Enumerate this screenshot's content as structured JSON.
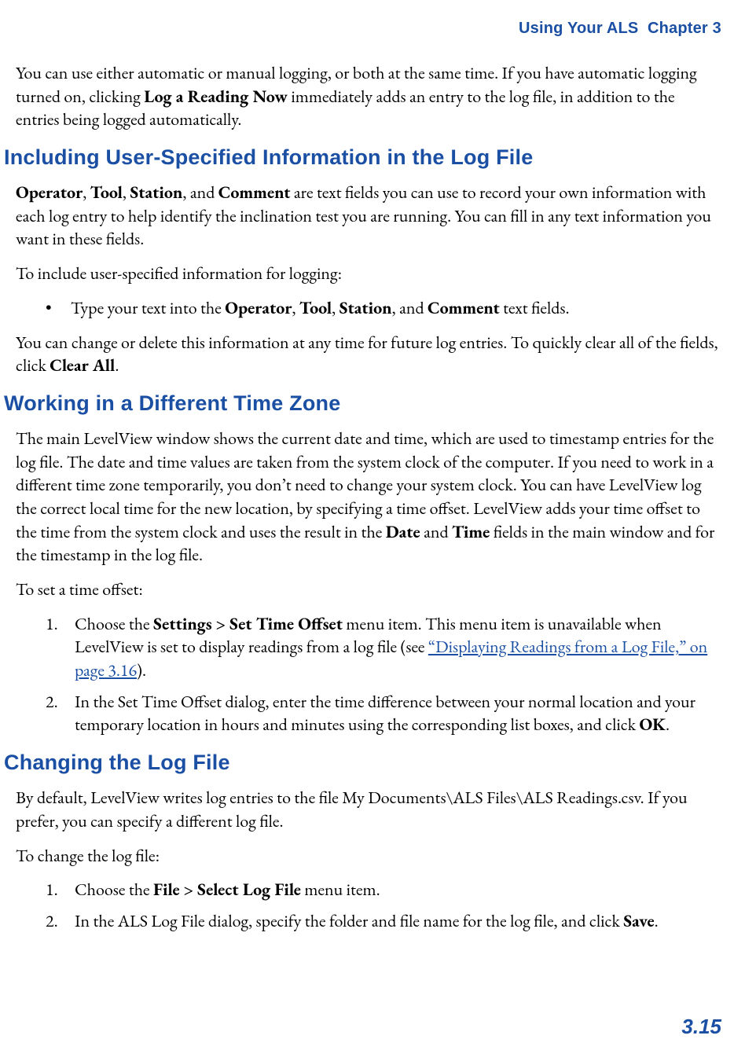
{
  "header": {
    "title": "Using Your ALS  Chapter 3"
  },
  "intro": {
    "p1_a": "You can use either automatic or manual logging, or both at the same time. If you have automatic logging turned on, clicking ",
    "p1_b": "Log a Reading Now",
    "p1_c": " immediately adds an entry to the log file, in addition to the entries being logged automatically."
  },
  "section1": {
    "heading": "Including User-Specified Information in the Log File",
    "p1_parts": {
      "a": "",
      "b": "Operator",
      "c": ", ",
      "d": "Tool",
      "e": ", ",
      "f": "Station",
      "g": ", and ",
      "h": "Comment",
      "i": " are text fields you can use to record your own information with each log entry to help identify the inclination test you are running. You can fill in any text information you want in these fields."
    },
    "p2": "To include user-specified information for logging:",
    "bullet1": {
      "a": "Type your text into the ",
      "b": "Operator",
      "c": ", ",
      "d": "Tool",
      "e": ", ",
      "f": "Station",
      "g": ", and ",
      "h": "Comment",
      "i": " text fields."
    },
    "p3_parts": {
      "a": "You can change or delete this information at any time for future log entries. To quickly clear all of the fields, click ",
      "b": "Clear All",
      "c": "."
    }
  },
  "section2": {
    "heading": "Working in a Different Time Zone",
    "p1_parts": {
      "a": "The main LevelView window shows the current date and time, which are used to timestamp entries for the log file. The date and time values are taken from the system clock of the computer. If you need to work in a different time zone temporarily, you don’t need to change your system clock. You can have LevelView log the correct local time for the new location, by specifying a time offset. LevelView adds your time offset to the time from the system clock and uses the result in the ",
      "b": "Date",
      "c": " and ",
      "d": "Time",
      "e": " fields in the main window and for the timestamp in the log file."
    },
    "p2": "To set a time offset:",
    "li1": {
      "a": "Choose the ",
      "b": "Settings > Set Time Offset",
      "c": " menu item. This menu item is unavailable when LevelView is set to display readings from a log file (see ",
      "link": "“Displaying Readings from a Log File,” on page 3.16",
      "d": ")."
    },
    "li2": {
      "a": "In the Set Time Offset dialog, enter the time difference between your normal location and your temporary location in hours and minutes using the corresponding list boxes, and click ",
      "b": "OK",
      "c": "."
    }
  },
  "section3": {
    "heading": "Changing the Log File",
    "p1": "By default, LevelView writes log entries to the file My Documents\\ALS Files\\ALS Readings.csv. If you prefer, you can specify a different log file.",
    "p2": "To change the log file:",
    "li1": {
      "a": "Choose the ",
      "b": "File > Select Log File",
      "c": " menu item."
    },
    "li2": {
      "a": "In the ALS Log File dialog, specify the folder and file name for the log file, and click ",
      "b": "Save",
      "c": "."
    }
  },
  "footer": {
    "page_num": "3.15"
  },
  "bullet_mark": "•"
}
